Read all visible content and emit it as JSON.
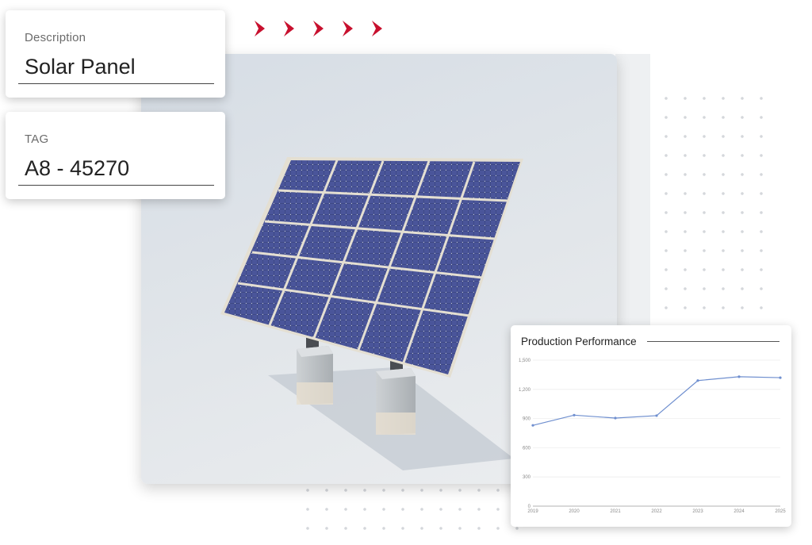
{
  "fields": {
    "description": {
      "label": "Description",
      "value": "Solar Panel"
    },
    "tag": {
      "label": "TAG",
      "value": "A8 - 45270"
    }
  },
  "decor": {
    "chevron_color": "#c8102e",
    "chevron_count": 5,
    "photo_subject": "solar panel on concrete supports"
  },
  "chart_data": {
    "type": "line",
    "title": "Production Performance",
    "x": [
      "2019",
      "2020",
      "2021",
      "2022",
      "2023",
      "2024",
      "2025"
    ],
    "series": [
      {
        "values": [
          830,
          935,
          905,
          930,
          1290,
          1330,
          1320
        ]
      }
    ],
    "yticks": [
      "0",
      "300",
      "600",
      "900",
      "1,200",
      "1,500"
    ],
    "ylim": [
      0,
      1500
    ],
    "grid": true,
    "line_color": "#6f8fcf"
  }
}
